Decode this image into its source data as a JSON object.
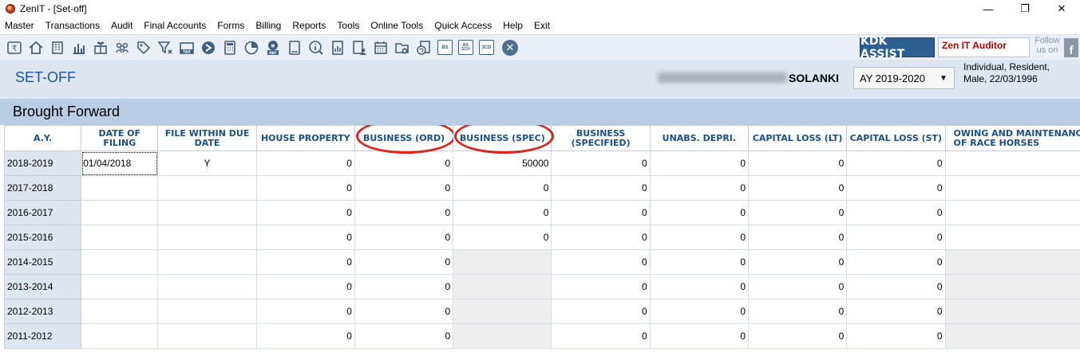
{
  "window": {
    "title": "ZenIT - [Set-off]",
    "minimize_glyph": "—",
    "maximize_glyph": "❐",
    "close_glyph": "✕"
  },
  "menu": [
    "Master",
    "Transactions",
    "Audit",
    "Final Accounts",
    "Forms",
    "Billing",
    "Reports",
    "Tools",
    "Online Tools",
    "Quick Access",
    "Help",
    "Exit"
  ],
  "toolbar": {
    "icons": [
      "rupee-icon",
      "home-icon",
      "building-icon",
      "bar-chart-icon",
      "gift-icon",
      "users-icon",
      "tag-icon",
      "filter-icon",
      "tax-icon",
      "arrow-icon",
      "calculator-icon",
      "pie-chart-icon",
      "pay-icon",
      "tablet-icon",
      "info-icon",
      "report-icon",
      "user-report-icon",
      "calendar-icon",
      "folder-add-icon",
      "refresh-doc-icon"
    ],
    "box_labels": {
      "bs": "BS",
      "bs_sch": "BS SCH",
      "cd": "3CD"
    },
    "close_glyph": "✕",
    "kdk_assist": "KDK ASSIST",
    "zen_auditor": "Zen IT Auditor",
    "follow_line1": "Follow",
    "follow_line2": "us on",
    "fb_glyph": "f"
  },
  "header": {
    "page_title": "SET-OFF",
    "person_surname": "SOLANKI",
    "assessment_year": "AY 2019-2020",
    "dropdown_glyph": "▼",
    "person_info_line1": "Individual, Resident,",
    "person_info_line2": "Male, 22/03/1996"
  },
  "section": {
    "title": "Brought Forward"
  },
  "grid": {
    "columns": {
      "ay": "A.Y.",
      "date_of_filing": "DATE OF FILING",
      "file_within_due_date": "FILE WITHIN DUE DATE",
      "house_property": "HOUSE PROPERTY",
      "business_ord": "BUSINESS (ORD)",
      "business_spec": "BUSINESS (SPEC)",
      "business_specified": "BUSINESS (SPECIFIED)",
      "unabs_depri": "UNABS. DEPRI.",
      "capital_loss_lt": "CAPITAL LOSS (LT)",
      "capital_loss_st": "CAPITAL LOSS (ST)",
      "owing_race_horses": "OWING AND MAINTENANCE OF RACE HORSES"
    },
    "rows": [
      {
        "ay": "2018-2019",
        "date": "01/04/2018",
        "within": "Y",
        "hp": "0",
        "ord": "0",
        "spec": "50000",
        "specified": "0",
        "unabs": "0",
        "lt": "0",
        "st": "0",
        "horses": ""
      },
      {
        "ay": "2017-2018",
        "date": "",
        "within": "",
        "hp": "0",
        "ord": "0",
        "spec": "0",
        "specified": "0",
        "unabs": "0",
        "lt": "0",
        "st": "0",
        "horses": ""
      },
      {
        "ay": "2016-2017",
        "date": "",
        "within": "",
        "hp": "0",
        "ord": "0",
        "spec": "0",
        "specified": "0",
        "unabs": "0",
        "lt": "0",
        "st": "0",
        "horses": ""
      },
      {
        "ay": "2015-2016",
        "date": "",
        "within": "",
        "hp": "0",
        "ord": "0",
        "spec": "0",
        "specified": "0",
        "unabs": "0",
        "lt": "0",
        "st": "0",
        "horses": ""
      },
      {
        "ay": "2014-2015",
        "date": "",
        "within": "",
        "hp": "0",
        "ord": "0",
        "spec": "",
        "specified": "0",
        "unabs": "0",
        "lt": "0",
        "st": "0",
        "horses": ""
      },
      {
        "ay": "2013-2014",
        "date": "",
        "within": "",
        "hp": "0",
        "ord": "0",
        "spec": "",
        "specified": "0",
        "unabs": "0",
        "lt": "0",
        "st": "0",
        "horses": ""
      },
      {
        "ay": "2012-2013",
        "date": "",
        "within": "",
        "hp": "0",
        "ord": "0",
        "spec": "",
        "specified": "0",
        "unabs": "0",
        "lt": "0",
        "st": "0",
        "horses": ""
      },
      {
        "ay": "2011-2012",
        "date": "",
        "within": "",
        "hp": "0",
        "ord": "0",
        "spec": "",
        "specified": "0",
        "unabs": "0",
        "lt": "0",
        "st": "0",
        "horses": ""
      }
    ]
  },
  "colors": {
    "accent": "#1a57a0",
    "header_band": "#dde6f1",
    "section_band": "#b9cde4",
    "annotation_red": "#e0241d",
    "kdk_blue": "#2d5f93"
  }
}
